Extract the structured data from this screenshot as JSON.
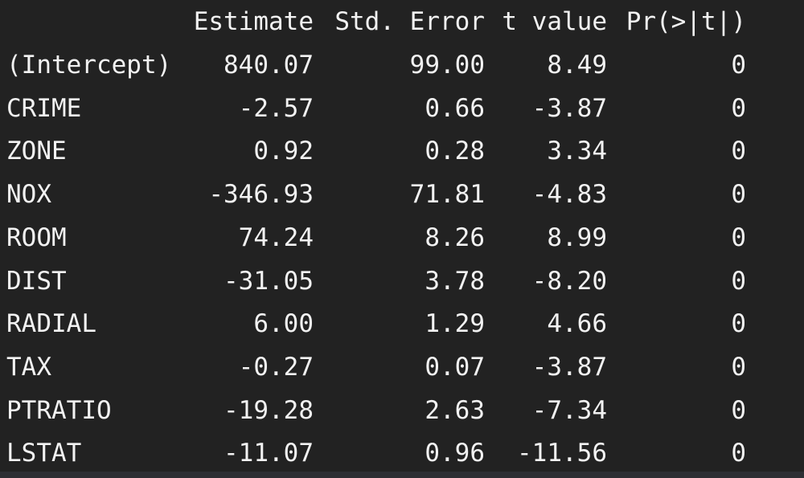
{
  "table": {
    "headers": [
      "",
      "Estimate",
      "Std. Error",
      "t value",
      "Pr(>|t|)"
    ],
    "rows": [
      [
        "(Intercept)",
        "840.07",
        "99.00",
        "8.49",
        "0"
      ],
      [
        "CRIME",
        "-2.57",
        "0.66",
        "-3.87",
        "0"
      ],
      [
        "ZONE",
        "0.92",
        "0.28",
        "3.34",
        "0"
      ],
      [
        "NOX",
        "-346.93",
        "71.81",
        "-4.83",
        "0"
      ],
      [
        "ROOM",
        "74.24",
        "8.26",
        "8.99",
        "0"
      ],
      [
        "DIST",
        "-31.05",
        "3.78",
        "-8.20",
        "0"
      ],
      [
        "RADIAL",
        "6.00",
        "1.29",
        "4.66",
        "0"
      ],
      [
        "TAX",
        "-0.27",
        "0.07",
        "-3.87",
        "0"
      ],
      [
        "PTRATIO",
        "-19.28",
        "2.63",
        "-7.34",
        "0"
      ],
      [
        "LSTAT",
        "-11.07",
        "0.96",
        "-11.56",
        "0"
      ]
    ]
  },
  "colors": {
    "background": "#222222",
    "text": "#f2f2f2",
    "bottom_bar": "#2d2e33"
  }
}
